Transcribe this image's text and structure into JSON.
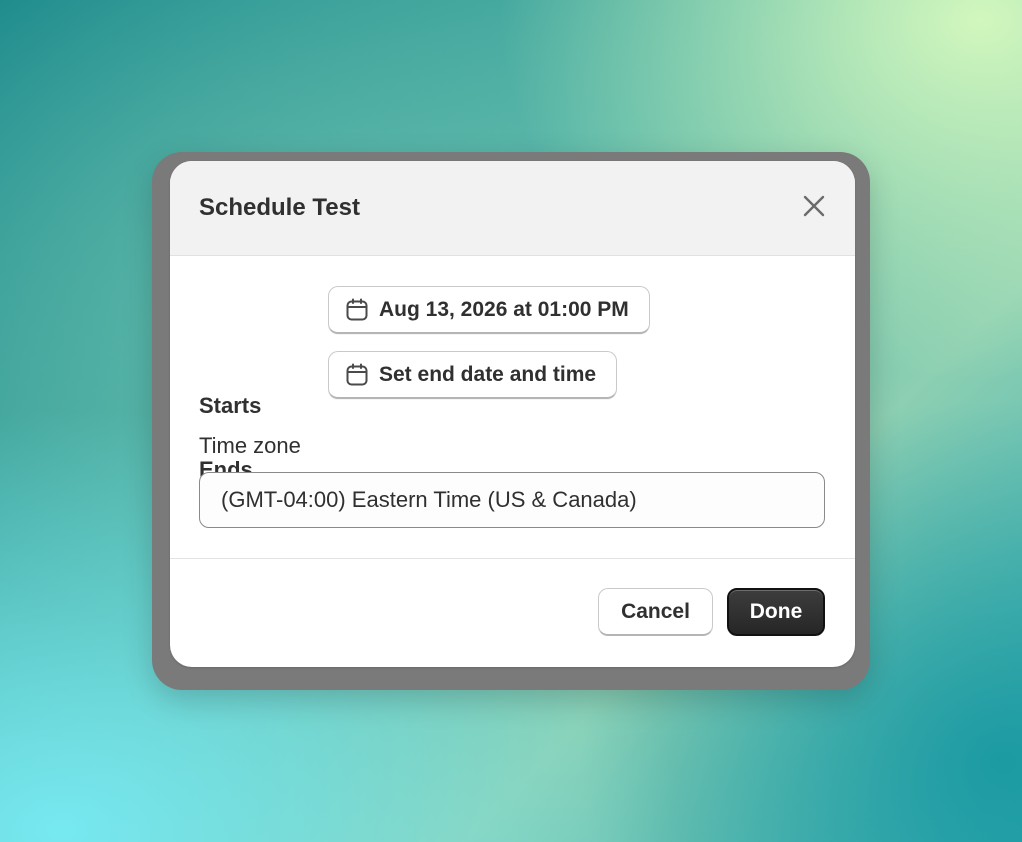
{
  "dialog": {
    "title": "Schedule Test",
    "close_icon": "close-icon"
  },
  "schedule": {
    "starts_label": "Starts",
    "starts_value": "Aug 13, 2026 at 01:00 PM",
    "ends_label": "Ends",
    "ends_value": "Set end date and time",
    "calendar_icon": "calendar-icon"
  },
  "timezone": {
    "label": "Time zone",
    "selected": "(GMT-04:00) Eastern Time (US & Canada)"
  },
  "footer": {
    "cancel_label": "Cancel",
    "done_label": "Done"
  },
  "colors": {
    "primary_button": "#303030",
    "header_background": "#f2f2f2",
    "text": "#303030"
  }
}
